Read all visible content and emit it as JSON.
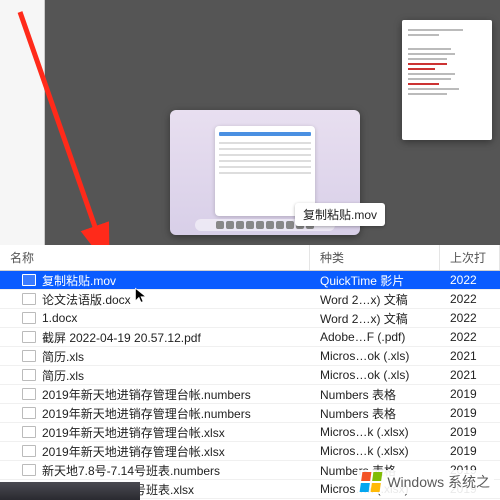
{
  "preview": {
    "thumb_label": "复制粘贴.mov"
  },
  "columns": {
    "name": "名称",
    "kind": "种类",
    "last": "上次打"
  },
  "files": [
    {
      "icon": "mov",
      "name": "复制粘贴.mov",
      "kind": "QuickTime 影片",
      "date": "2022",
      "selected": true
    },
    {
      "icon": "doc",
      "name": "论文法语版.docx",
      "kind": "Word 2…x) 文稿",
      "date": "2022"
    },
    {
      "icon": "doc",
      "name": "1.docx",
      "kind": "Word 2…x) 文稿",
      "date": "2022"
    },
    {
      "icon": "pdf",
      "name": "截屏 2022-04-19 20.57.12.pdf",
      "kind": "Adobe…F (.pdf)",
      "date": "2022"
    },
    {
      "icon": "xls",
      "name": "简历.xls",
      "kind": "Micros…ok (.xls)",
      "date": "2021"
    },
    {
      "icon": "xls",
      "name": "简历.xls",
      "kind": "Micros…ok (.xls)",
      "date": "2021"
    },
    {
      "icon": "num",
      "name": "2019年新天地进销存管理台帐.numbers",
      "kind": "Numbers 表格",
      "date": "2019"
    },
    {
      "icon": "num",
      "name": "2019年新天地进销存管理台帐.numbers",
      "kind": "Numbers 表格",
      "date": "2019"
    },
    {
      "icon": "xls",
      "name": "2019年新天地进销存管理台帐.xlsx",
      "kind": "Micros…k (.xlsx)",
      "date": "2019"
    },
    {
      "icon": "xls",
      "name": "2019年新天地进销存管理台帐.xlsx",
      "kind": "Micros…k (.xlsx)",
      "date": "2019"
    },
    {
      "icon": "num",
      "name": "新天地7.8号-7.14号班表.numbers",
      "kind": "Numbers 表格",
      "date": "2019"
    },
    {
      "icon": "xls",
      "name": "新天地7.8号-7.14号班表.xlsx",
      "kind": "Micros…k (.xlsx)",
      "date": "2019"
    }
  ],
  "watermark": "Windows 系统之"
}
